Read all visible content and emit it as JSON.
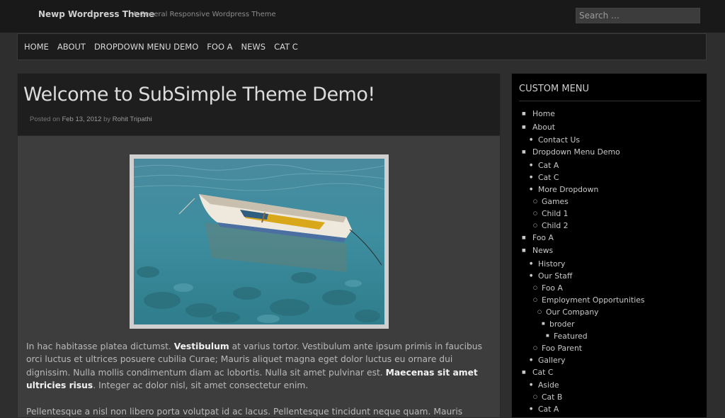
{
  "site": {
    "title": "Newp Wordpress Theme",
    "description": "A General Responsive Wordpress Theme"
  },
  "search": {
    "placeholder": "Search …"
  },
  "nav": {
    "items": [
      "HOME",
      "ABOUT",
      "DROPDOWN MENU DEMO",
      "FOO A",
      "NEWS",
      "CAT C"
    ]
  },
  "post": {
    "title": "Welcome to SubSimple Theme Demo!",
    "meta_posted": "Posted on",
    "meta_date": "Feb 13, 2012",
    "meta_by": "by",
    "meta_author": "Rohit Tripathi",
    "image": "boat-on-clear-water",
    "p1": [
      "In hac habitasse platea dictumst. ",
      "Vestibulum",
      " at varius tortor. Vestibulum ante ipsum primis in faucibus orci luctus et ultrices posuere cubilia Curae; Mauris aliquet magna eget dolor luctus eu ornare dui dignissim. Nulla mollis condimentum diam ac lobortis. Nulla sit amet pulvinar est. ",
      "Maecenas sit amet ultricies risus",
      ". Integer ac dolor nisl, sit amet consectetur enim."
    ],
    "p2": "Pellentesque a nisl non libero porta volutpat id ac lacus. Pellentesque tincidunt neque quam. Mauris"
  },
  "sidebar": {
    "heading": "CUSTOM MENU",
    "menu": [
      {
        "label": "Home",
        "level": 0
      },
      {
        "label": "About",
        "level": 0
      },
      {
        "label": "Contact Us",
        "level": 1
      },
      {
        "label": "Dropdown Menu Demo",
        "level": 0
      },
      {
        "label": "Cat A",
        "level": 1
      },
      {
        "label": "Cat C",
        "level": 1
      },
      {
        "label": "More Dropdown",
        "level": 1
      },
      {
        "label": "Games",
        "level": 2
      },
      {
        "label": "Child 1",
        "level": 2
      },
      {
        "label": "Child 2",
        "level": 2
      },
      {
        "label": "Foo A",
        "level": 0
      },
      {
        "label": "News",
        "level": 0
      },
      {
        "label": "History",
        "level": 1
      },
      {
        "label": "Our Staff",
        "level": 1
      },
      {
        "label": "Foo A",
        "level": 2
      },
      {
        "label": "Employment Opportunities",
        "level": 2
      },
      {
        "label": "Our Company",
        "level": 3
      },
      {
        "label": "broder",
        "level": 4
      },
      {
        "label": "Featured",
        "level": 5
      },
      {
        "label": "Foo Parent",
        "level": 2
      },
      {
        "label": "Gallery",
        "level": 1
      },
      {
        "label": "Cat C",
        "level": 0
      },
      {
        "label": "Aside",
        "level": 1
      },
      {
        "label": "Cat B",
        "level": 2
      },
      {
        "label": "Cat A",
        "level": 1
      }
    ]
  },
  "colors": {
    "background": "#2e2e2e",
    "topbar": "#191919",
    "sidebar": "#000000",
    "highlight_text": "#f2f2f2"
  }
}
